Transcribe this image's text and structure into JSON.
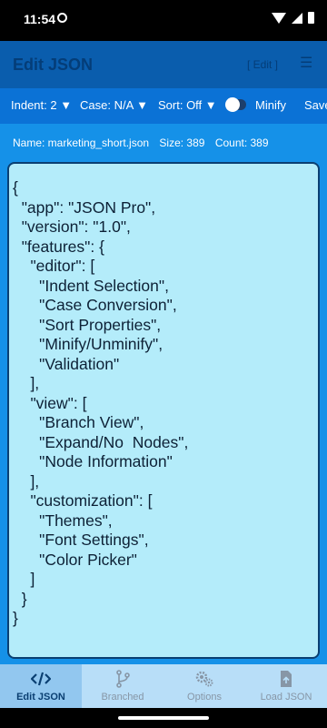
{
  "status": {
    "time": "11:54"
  },
  "app_bar": {
    "title": "Edit JSON",
    "mode": "[ Edit ]",
    "menu": "☰"
  },
  "toolbar": {
    "indent": "Indent: 2 ▼",
    "case": "Case: N/A ▼",
    "sort": "Sort: Off ▼",
    "minify": "Minify",
    "save": "Save"
  },
  "file_info": {
    "name": "Name: marketing_short.json",
    "size": "Size: 389",
    "count": "Count: 389"
  },
  "json_text": "{\n  \"app\": \"JSON Pro\",\n  \"version\": \"1.0\",\n  \"features\": {\n    \"editor\": [\n      \"Indent Selection\",\n      \"Case Conversion\",\n      \"Sort Properties\",\n      \"Minify/Unminify\",\n      \"Validation\"\n    ],\n    \"view\": [\n      \"Branch View\",\n      \"Expand/No  Nodes\",\n      \"Node Information\"\n    ],\n    \"customization\": [\n      \"Themes\",\n      \"Font Settings\",\n      \"Color Picker\"\n    ]\n  }\n}",
  "nav": [
    {
      "label": "Edit JSON",
      "icon": "code-icon",
      "active": true
    },
    {
      "label": "Branched",
      "icon": "branch-icon",
      "active": false
    },
    {
      "label": "Options",
      "icon": "gears-icon",
      "active": false
    },
    {
      "label": "Load JSON",
      "icon": "load-file-icon",
      "active": false
    }
  ],
  "colors": {
    "app_bar": "#0a5dad",
    "toolbar": "#0b72d6",
    "content_bg": "#1591e8",
    "editor_bg": "#b4ecfa",
    "nav_bg": "#b8def8",
    "nav_active": "#92c7ef"
  }
}
